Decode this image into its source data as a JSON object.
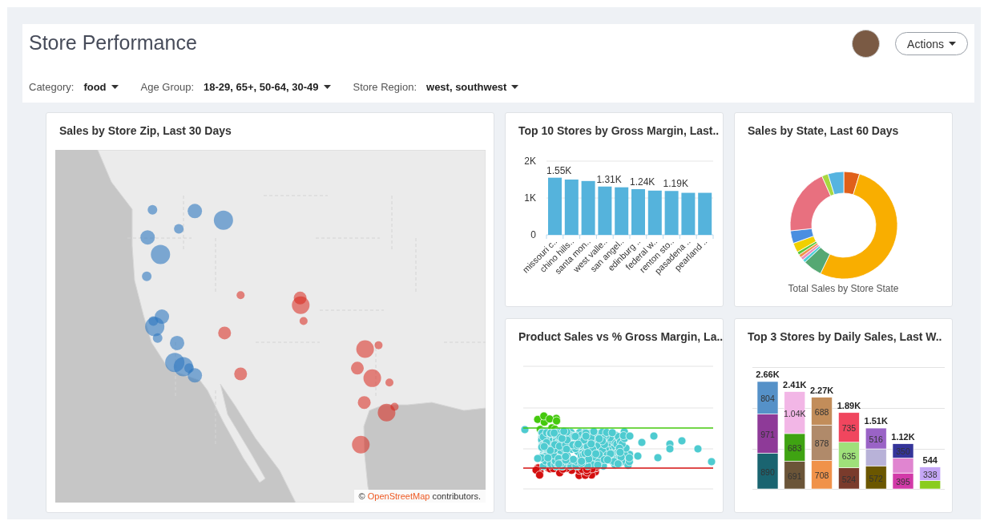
{
  "header": {
    "title": "Store Performance",
    "actions_button": "Actions"
  },
  "filters": [
    {
      "label": "Category:",
      "value": "food"
    },
    {
      "label": "Age Group:",
      "value": "18-29, 65+, 50-64, 30-49"
    },
    {
      "label": "Store Region:",
      "value": "west, southwest"
    }
  ],
  "cards": [
    {
      "kind": "map",
      "title": "Sales by Store Zip, Last 30 Days",
      "attribution": {
        "prefix": "©",
        "link": "OpenStreetMap",
        "suffix": "contributors."
      }
    },
    {
      "kind": "bar",
      "title": "Top 10 Stores by Gross Margin, Last..",
      "chart_data": {
        "type": "bar",
        "categories": [
          "missouri c..",
          "chino hills..",
          "santa mon..",
          "west valle..",
          "san angel..",
          "edinburg ..",
          "federal w..",
          "renton sto..",
          "pasadena ..",
          "pearland .."
        ],
        "series": [
          {
            "color": "#55b3dc",
            "values": [
              1550,
              1500,
              1460,
              1310,
              1290,
              1240,
              1200,
              1190,
              1140,
              1140
            ]
          }
        ],
        "value_labels": [
          "1.55K",
          null,
          null,
          "1.31K",
          null,
          "1.24K",
          null,
          "1.19K",
          null,
          null
        ],
        "ylim": [
          0,
          2000
        ],
        "yticks": [
          0,
          {
            "value": 1000,
            "label": "1K"
          },
          {
            "value": 2000,
            "label": "2K"
          }
        ]
      }
    },
    {
      "kind": "donut",
      "title": "Sales by State, Last 60 Days",
      "caption": "Total Sales by Store State"
    },
    {
      "kind": "scatter",
      "title": "Product Sales vs % Gross Margin, La.."
    },
    {
      "kind": "stacked",
      "title": "Top 3 Stores by Daily Sales, Last W..",
      "chart_data": {
        "type": "bar",
        "stacked": true,
        "series": [
          {
            "colors": [
              "#1a6470",
              "#6b5538",
              "#f0924a",
              "#7a3b2c",
              "#6b5700",
              "#d23aa8",
              "#8acc1e"
            ],
            "values": [
              890,
              691,
              708,
              524,
              572,
              395,
              206
            ],
            "value_labels": [
              "890",
              "691",
              "708",
              "524",
              "572",
              "395",
              null
            ]
          },
          {
            "colors": [
              "#8e3a98",
              "#3fa312",
              "#b08a6a",
              "#9fe07a",
              "#b8b2d8",
              "#e085d0",
              null
            ],
            "values": [
              971,
              683,
              878,
              635,
              422,
              375,
              null
            ],
            "value_labels": [
              "971",
              "683",
              "878",
              "635",
              null,
              null,
              null
            ]
          },
          {
            "colors": [
              "#5591c8",
              "#f2b6e6",
              "#c28d5a",
              "#f0465e",
              "#9a63c6",
              "#34349a",
              "#c4a6f6"
            ],
            "values": [
              804,
              1040,
              688,
              735,
              516,
              350,
              338
            ],
            "value_labels": [
              "804",
              "1.04K",
              "688",
              "735",
              "516",
              "350",
              "338"
            ]
          }
        ],
        "annotations": [
          "2.66K",
          "2.41K",
          "2.27K",
          "1.89K",
          "1.51K",
          "1.12K",
          "544"
        ]
      }
    }
  ]
}
